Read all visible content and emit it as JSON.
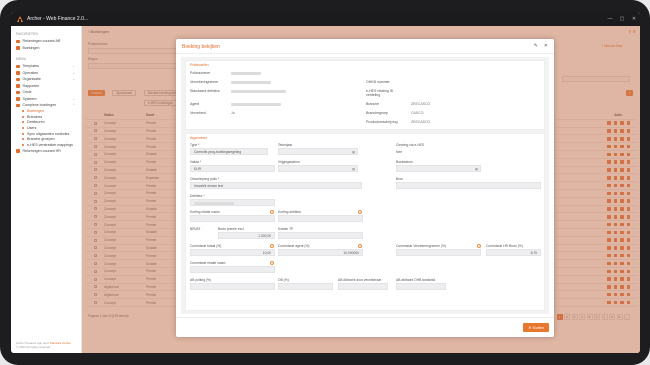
{
  "window": {
    "title": "Archer - Web Finance 2.0...",
    "controls": {
      "minimize": "—",
      "maximize": "▢",
      "close": "✕"
    }
  },
  "sidebar": {
    "favorites_header": "FAVORIETEN",
    "favorites": [
      {
        "label": "Rekeningen courant AR",
        "icon": "doc-icon"
      },
      {
        "label": "Boekingen",
        "icon": "doc-icon"
      }
    ],
    "menu_header": "MENU",
    "menu": [
      {
        "label": "Templates",
        "chevron": true
      },
      {
        "label": "Operaties",
        "chevron": true
      },
      {
        "label": "Organisatie",
        "chevron": true
      },
      {
        "label": "Rapporten",
        "chevron": false
      },
      {
        "label": "Crisis",
        "chevron": false
      },
      {
        "label": "Systeem",
        "chevron": true
      },
      {
        "label": "Complexe boekingen",
        "chevron": true
      }
    ],
    "submenu": [
      {
        "label": "Boekingen",
        "active": true
      },
      {
        "label": "Branches",
        "active": false
      },
      {
        "label": "Debiteuren",
        "active": false
      },
      {
        "label": "Users",
        "active": false
      },
      {
        "label": "Sync uitgaanden controles",
        "active": false
      },
      {
        "label": "Branche groepen",
        "active": false
      },
      {
        "label": "e-HES verstrekker mappings",
        "active": false
      }
    ],
    "extra": {
      "label": "Rekeningen courant HR"
    },
    "footer": {
      "line1": "Archer Finance app door",
      "link": "Pandora Online",
      "line2": "© 2024 all rights reserved"
    }
  },
  "background": {
    "breadcrumb": "‹ Boekingen",
    "search_label": "Polisnummer",
    "search2_label": "Rayon",
    "btn_filter": "Zoeken",
    "btn_clear": "Opschonen",
    "btn_add": "Nieuwe boeking invoeren",
    "btn_export": "e-HES boekingen",
    "filter_right": "‹ Nieuwe flow",
    "table_headers": [
      "Status",
      "Soort",
      "Actie"
    ],
    "rows": [
      {
        "status": "Concept",
        "type": "Premie"
      },
      {
        "status": "Concept",
        "type": "Premie"
      },
      {
        "status": "Concept",
        "type": "Premie"
      },
      {
        "status": "Concept",
        "type": "Premie"
      },
      {
        "status": "Concept",
        "type": "Schade"
      },
      {
        "status": "Concept",
        "type": "Premie"
      },
      {
        "status": "Concept",
        "type": "Schade"
      },
      {
        "status": "Concept",
        "type": "Expertise"
      },
      {
        "status": "Concept",
        "type": "Premie"
      },
      {
        "status": "Concept",
        "type": "Premie"
      },
      {
        "status": "Concept",
        "type": "Premie"
      },
      {
        "status": "Concept",
        "type": "Schade"
      },
      {
        "status": "Concept",
        "type": "Premie"
      },
      {
        "status": "Concept",
        "type": "Premie"
      },
      {
        "status": "Concept",
        "type": "Schade"
      },
      {
        "status": "Concept",
        "type": "Premie"
      },
      {
        "status": "Concept",
        "type": "Schade"
      },
      {
        "status": "Concept",
        "type": "Premie"
      },
      {
        "status": "Concept",
        "type": "Schade"
      },
      {
        "status": "Concept",
        "type": "Premie"
      },
      {
        "status": "Concept",
        "type": "Premie"
      },
      {
        "status": "Afgekeurd",
        "type": "Premie"
      },
      {
        "status": "Afgekeurd",
        "type": "Premie"
      },
      {
        "status": "Concept",
        "type": "Premie"
      }
    ],
    "pager_info": "Pagina 1 van 9 (129 items)",
    "pages": [
      "1",
      "2",
      "3",
      "4",
      "5",
      "6",
      "7",
      "8",
      "9",
      "›"
    ]
  },
  "modal": {
    "title": "Boeking bekijken",
    "icons": {
      "edit": "✎",
      "close": "✕"
    },
    "sec1": {
      "title": "Polisvariën",
      "left": [
        {
          "label": "Polisnummer"
        },
        {
          "label": "Verzekeringnemer"
        },
        {
          "label": "Standaard debiteur"
        },
        {
          "label": "Agent"
        },
        {
          "label": "Verzekerd",
          "value": "Ja"
        }
      ],
      "right": [
        {
          "label": "OHKB nummer",
          "value": ""
        },
        {
          "label": "e-HES relating ID verdeling",
          "value": ""
        },
        {
          "label": "Branche",
          "value": "ZEECASCO"
        },
        {
          "label": "Branchegroep",
          "value": "CASCO"
        },
        {
          "label": "Productomschrijving",
          "value": "ZEECASCO"
        }
      ]
    },
    "sec2": {
      "title": "Algemeen",
      "type_label": "Type *",
      "type_value": "Correctie-prog-boekingsregeling",
      "teken_label": "Tekenjaar",
      "clearing_label": "Clearing via e-HES",
      "clearing_value": "Nee",
      "valuta_label": "Valuta *",
      "valuta_value": "EUR",
      "vrij_label": "Vrijgingsdatum",
      "boekdatum_label": "Boekdatum",
      "omschr_label": "Omschrijving polis *",
      "omschr_value": "Inovatrik shown text",
      "bron_label": "Bron",
      "debiteur_label": "Debiteur *",
      "korting_nota_label": "Korting relatie naam",
      "korting_deb_label": "Korting debiteur",
      "brvat_label": "BRVAT",
      "bruto_label": "Bruto premie excl",
      "bruto_value": "1.300,00",
      "kosten_label": "Kosten TP",
      "prov_label": "Commissie totaal (%)",
      "prov_value": "10,00",
      "prov_agent_label": "Commissie agent (%)",
      "prov_agent_value": "10,000000",
      "prov_verz_label": "Commissie Verzekeringnemer (%)",
      "prov_hr_label": "Commissie HR Bruto (%)",
      "prov_hr_value": "8,75",
      "comm_rel_label": "Commissie relatie naam",
      "ab_polis_label": "AB polting (%)",
      "ob_label": "OB (%)",
      "ab_afdr_label": "AB Afdracht door verzekeraar",
      "ab_ohb_label": "AB afdracht OHB landsrisk"
    },
    "close_button": "✕ Sluiten"
  }
}
